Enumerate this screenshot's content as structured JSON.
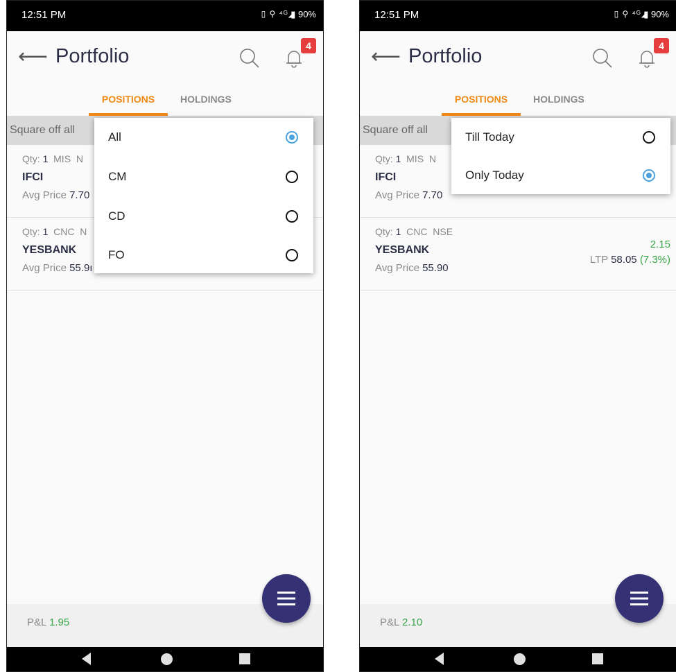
{
  "status_bar": {
    "time": "12:51 PM",
    "signal_text": "▯ ⚲ ⁴ᴳ◢",
    "battery": "▮ 90%"
  },
  "header": {
    "title": "Portfolio",
    "notification_count": "4"
  },
  "tabs": [
    {
      "label": "POSITIONS",
      "active": true
    },
    {
      "label": "HOLDINGS",
      "active": false
    }
  ],
  "square_off_label": "Square off all",
  "left_screen": {
    "positions": [
      {
        "qty_label": "Qty:",
        "qty": "1",
        "product": "MIS",
        "exchange": "N",
        "symbol": "IFCI",
        "avg_label": "Avg Price",
        "avg_price": "7.70"
      },
      {
        "qty_label": "Qty:",
        "qty": "1",
        "product": "CNC",
        "exchange": "N",
        "symbol": "YESBANK",
        "avg_label": "Avg Price",
        "avg_price": "55.9ı"
      }
    ],
    "segment_menu": [
      {
        "label": "All",
        "selected": true
      },
      {
        "label": "CM",
        "selected": false
      },
      {
        "label": "CD",
        "selected": false
      },
      {
        "label": "FO",
        "selected": false
      }
    ],
    "pl_label": "P&L",
    "pl_value": "1.95"
  },
  "right_screen": {
    "positions": [
      {
        "qty_label": "Qty:",
        "qty": "1",
        "product": "MIS",
        "exchange": "N",
        "symbol": "IFCI",
        "avg_label": "Avg Price",
        "avg_price": "7.70"
      },
      {
        "qty_label": "Qty:",
        "qty": "1",
        "product": "CNC",
        "exchange": "NSE",
        "symbol": "YESBANK",
        "avg_label": "Avg Price",
        "avg_price": "55.90",
        "pnl": "2.15",
        "ltp_label": "LTP",
        "ltp": "58.05",
        "change": "(7.3%)"
      }
    ],
    "day_menu": [
      {
        "label": "Till Today",
        "selected": false
      },
      {
        "label": "Only Today",
        "selected": true
      }
    ],
    "pl_label": "P&L",
    "pl_value": "2.10"
  },
  "colors": {
    "accent": "#ef8a17",
    "fab": "#343274",
    "positive": "#3aa64a",
    "radio_selected": "#4aa3df",
    "badge": "#e63d3d"
  },
  "icons": [
    "back-arrow-icon",
    "search-icon",
    "bell-icon",
    "menu-icon",
    "nav-back-icon",
    "nav-home-icon",
    "nav-recents-icon"
  ]
}
